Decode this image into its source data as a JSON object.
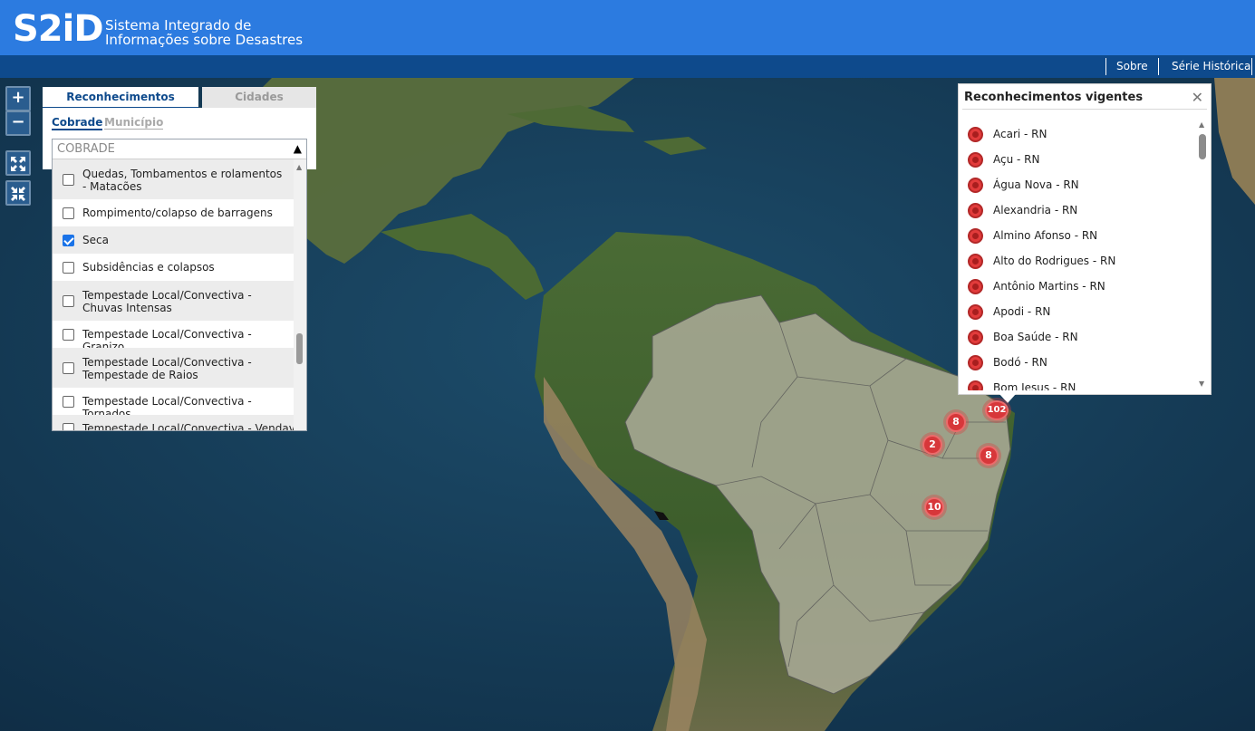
{
  "header": {
    "logo": "S2iD",
    "system_name_line1": "Sistema Integrado de",
    "system_name_line2": "Informações sobre Desastres"
  },
  "nav": {
    "sobre": "Sobre",
    "serie_historica": "Série Histórica"
  },
  "map_controls": {
    "zoom_in": "+",
    "zoom_out": "−"
  },
  "left_panel": {
    "tabs": [
      "Reconhecimentos vigentes",
      "Cidades resilientes"
    ],
    "subtabs": [
      "Cobrade",
      "Município"
    ],
    "dropdown": {
      "placeholder": "COBRADE",
      "items": [
        {
          "label": "Quedas, Tombamentos e rolamentos - Matacões",
          "checked": false
        },
        {
          "label": "Rompimento/colapso de barragens",
          "checked": false
        },
        {
          "label": "Seca",
          "checked": true
        },
        {
          "label": "Subsidências e colapsos",
          "checked": false
        },
        {
          "label": "Tempestade Local/Convectiva - Chuvas Intensas",
          "checked": false
        },
        {
          "label": "Tempestade Local/Convectiva - Granizo",
          "checked": false
        },
        {
          "label": "Tempestade Local/Convectiva - Tempestade de Raios",
          "checked": false
        },
        {
          "label": "Tempestade Local/Convectiva - Tornados",
          "checked": false
        },
        {
          "label": "Tempestade Local/Convectiva - Vendaval",
          "checked": false
        }
      ]
    }
  },
  "popup": {
    "title": "Reconhecimentos vigentes",
    "close": "✕",
    "items": [
      "Acari - RN",
      "Açu - RN",
      "Água Nova - RN",
      "Alexandria - RN",
      "Almino Afonso - RN",
      "Alto do Rodrigues - RN",
      "Antônio Martins - RN",
      "Apodi - RN",
      "Boa Saúde - RN",
      "Bodó - RN",
      "Bom Jesus - RN"
    ]
  },
  "markers": [
    "102",
    "8",
    "2",
    "8",
    "10"
  ],
  "colors": {
    "header_blue": "#2c7be0",
    "nav_blue": "#0e4a8c",
    "marker_red": "#d7373a"
  }
}
